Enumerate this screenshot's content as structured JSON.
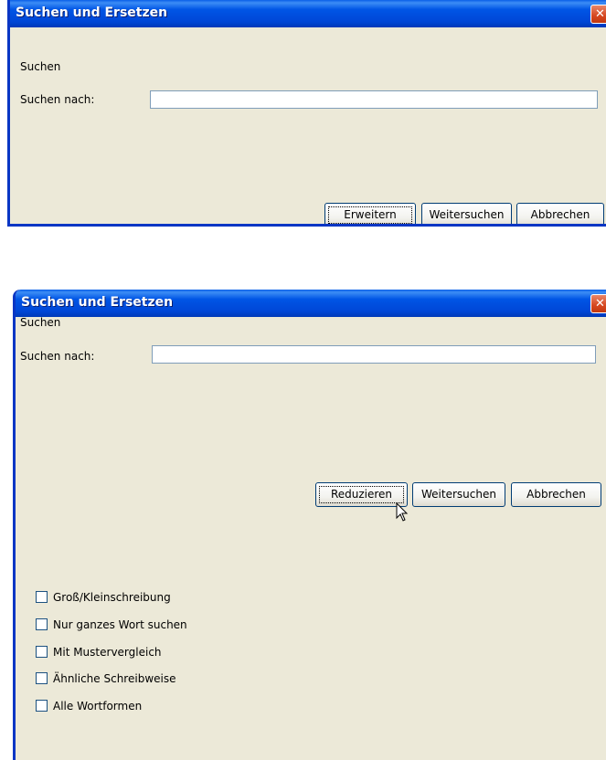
{
  "collapsed_dialog": {
    "title": "Suchen und Ersetzen",
    "close_glyph": "✕",
    "section_label": "Suchen",
    "search_label": "Suchen nach:",
    "search_value": "",
    "buttons": {
      "expand": "Erweitern",
      "find_next": "Weitersuchen",
      "cancel": "Abbrechen"
    }
  },
  "expanded_dialog": {
    "title": "Suchen und Ersetzen",
    "close_glyph": "✕",
    "section_label": "Suchen",
    "search_label": "Suchen nach:",
    "search_value": "",
    "buttons": {
      "reduce": "Reduzieren",
      "find_next": "Weitersuchen",
      "cancel": "Abbrechen"
    },
    "options": [
      {
        "label": "Groß/Kleinschreibung",
        "checked": false
      },
      {
        "label": "Nur ganzes Wort suchen",
        "checked": false
      },
      {
        "label": "Mit Mustervergleich",
        "checked": false
      },
      {
        "label": "Ähnliche Schreibweise",
        "checked": false
      },
      {
        "label": "Alle Wortformen",
        "checked": false
      }
    ]
  },
  "colors": {
    "titlebar": "#0055e5",
    "dialog_bg": "#ece9d8",
    "close_button": "#d64720"
  },
  "icons": [
    "close-icon",
    "mouse-cursor-icon",
    "checkbox-icon"
  ]
}
